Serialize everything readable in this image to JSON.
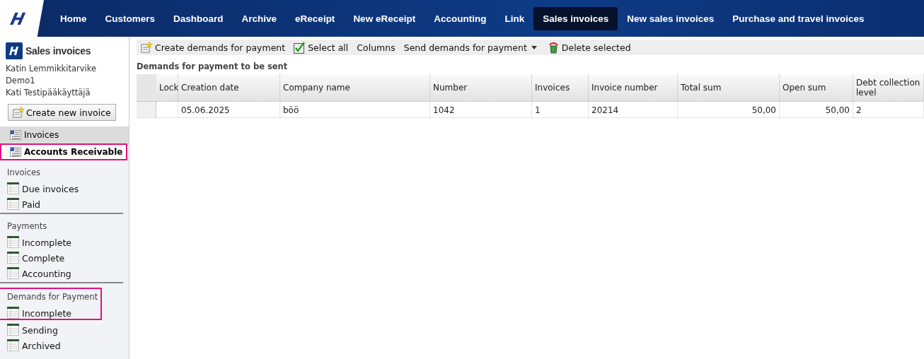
{
  "nav": {
    "items": [
      {
        "label": "Home",
        "selected": false
      },
      {
        "label": "Customers",
        "selected": false
      },
      {
        "label": "Dashboard",
        "selected": false
      },
      {
        "label": "Archive",
        "selected": false
      },
      {
        "label": "eReceipt",
        "selected": false
      },
      {
        "label": "New eReceipt",
        "selected": false
      },
      {
        "label": "Accounting",
        "selected": false
      },
      {
        "label": "Link",
        "selected": false
      },
      {
        "label": "Sales invoices",
        "selected": true
      },
      {
        "label": "New sales invoices",
        "selected": false
      },
      {
        "label": "Purchase and travel invoices",
        "selected": false
      }
    ]
  },
  "sidebar": {
    "title": "Sales invoices",
    "user_lines": [
      "Katin Lemmikkitarvike",
      "Demo1",
      "Kati Testipääkäyttäjä"
    ],
    "create_button": "Create new invoice",
    "sections": [
      {
        "label": "Invoices",
        "highlighted": false
      },
      {
        "label": "Accounts Receivable",
        "highlighted": true
      }
    ],
    "groups": [
      {
        "heading": "Invoices",
        "highlighted": false,
        "items": [
          "Due invoices",
          "Paid"
        ]
      },
      {
        "heading": "Payments",
        "highlighted": false,
        "items": [
          "Incomplete",
          "Complete",
          "Accounting"
        ]
      },
      {
        "heading": "Demands for Payment",
        "highlighted": true,
        "items": [
          "Incomplete",
          "Sending",
          "Archived"
        ]
      }
    ]
  },
  "toolbar": [
    {
      "kind": "create",
      "label": "Create demands for payment"
    },
    {
      "kind": "check",
      "label": "Select all"
    },
    {
      "kind": "plain",
      "label": "Columns"
    },
    {
      "kind": "dropdown",
      "label": "Send demands for payment"
    },
    {
      "kind": "delete",
      "label": "Delete selected"
    }
  ],
  "table": {
    "title": "Demands for payment to be sent",
    "columns": [
      "Lock",
      "Creation date",
      "Company name",
      "Number",
      "Invoices",
      "Invoice number",
      "Total sum",
      "Open sum",
      "Debt collection level"
    ],
    "rows": [
      [
        "",
        "05.06.2025",
        "böö",
        "1042",
        "1",
        "20214",
        "50,00",
        "50,00",
        "2"
      ]
    ]
  }
}
